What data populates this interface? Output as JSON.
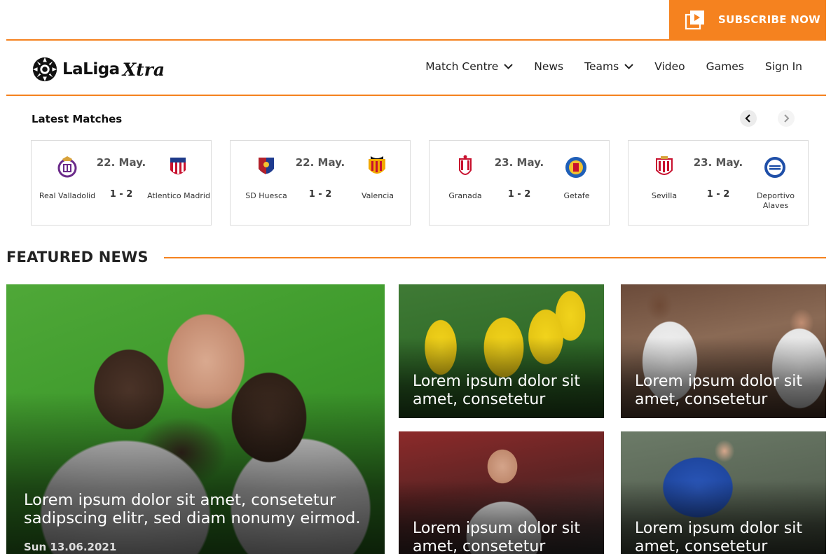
{
  "subscribe": {
    "label": "SUBSCRIBE NOW",
    "icon": "video-play-icon"
  },
  "brand": {
    "logo_main": "LaLiga",
    "logo_accent": "Xtra"
  },
  "nav": {
    "items": [
      {
        "label": "Match Centre",
        "has_dropdown": true
      },
      {
        "label": "News",
        "has_dropdown": false
      },
      {
        "label": "Teams",
        "has_dropdown": true
      },
      {
        "label": "Video",
        "has_dropdown": false
      },
      {
        "label": "Games",
        "has_dropdown": false
      },
      {
        "label": "Sign In",
        "has_dropdown": false
      }
    ]
  },
  "latest": {
    "title": "Latest Matches",
    "matches": [
      {
        "date": "22. May.",
        "score": "1 - 2",
        "home": "Real Valladolid",
        "away": "Atlentico Madrid"
      },
      {
        "date": "22. May.",
        "score": "1 - 2",
        "home": "SD Huesca",
        "away": "Valencia"
      },
      {
        "date": "23. May.",
        "score": "1 - 2",
        "home": "Granada",
        "away": "Getafe"
      },
      {
        "date": "23. May.",
        "score": "1 - 2",
        "home": "Sevilla",
        "away": "Deportivo Alaves"
      }
    ]
  },
  "featured": {
    "title": "FEATURED NEWS",
    "main": {
      "headline": "Lorem ipsum dolor sit amet, consetetur sadipscing elitr, sed diam nonumy eirmod.",
      "date": "Sun 13.06.2021"
    },
    "tiles": [
      {
        "headline": "Lorem ipsum dolor sit amet, consetetur"
      },
      {
        "headline": "Lorem ipsum dolor sit amet, consetetur"
      },
      {
        "headline": "Lorem ipsum dolor sit amet, consetetur"
      },
      {
        "headline": "Lorem ipsum dolor sit amet, consetetur"
      }
    ]
  },
  "colors": {
    "accent": "#f5821f"
  }
}
